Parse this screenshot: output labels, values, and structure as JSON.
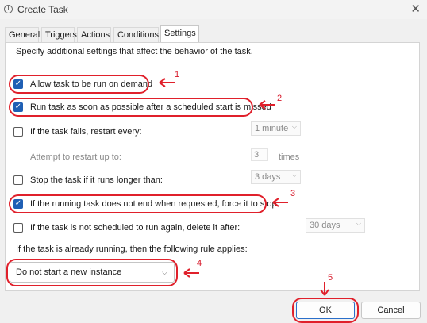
{
  "window": {
    "title": "Create Task",
    "close_glyph": "✕"
  },
  "tabs": [
    {
      "label": "General"
    },
    {
      "label": "Triggers"
    },
    {
      "label": "Actions"
    },
    {
      "label": "Conditions"
    },
    {
      "label": "Settings",
      "active": true
    }
  ],
  "settings": {
    "description": "Specify additional settings that affect the behavior of the task.",
    "allow_on_demand": {
      "label": "Allow task to be run on demand",
      "checked": true
    },
    "run_asap": {
      "label": "Run task as soon as possible after a scheduled start is missed",
      "checked": true
    },
    "restart_on_fail": {
      "label": "If the task fails, restart every:",
      "checked": false,
      "interval": "1 minute"
    },
    "restart_attempts": {
      "label": "Attempt to restart up to:",
      "value": "3",
      "unit": "times"
    },
    "stop_if_longer": {
      "label": "Stop the task if it runs longer than:",
      "checked": false,
      "duration": "3 days"
    },
    "force_stop": {
      "label": "If the running task does not end when requested, force it to stop",
      "checked": true
    },
    "delete_if_not_scheduled": {
      "label": "If the task is not scheduled to run again, delete it after:",
      "checked": false,
      "duration": "30 days"
    },
    "rule_label": "If the task is already running, then the following rule applies:",
    "rule_value": "Do not start a new instance"
  },
  "buttons": {
    "ok": "OK",
    "cancel": "Cancel"
  },
  "annotations": {
    "color": "#e0202b",
    "labels": [
      "1",
      "2",
      "3",
      "4",
      "5"
    ]
  }
}
